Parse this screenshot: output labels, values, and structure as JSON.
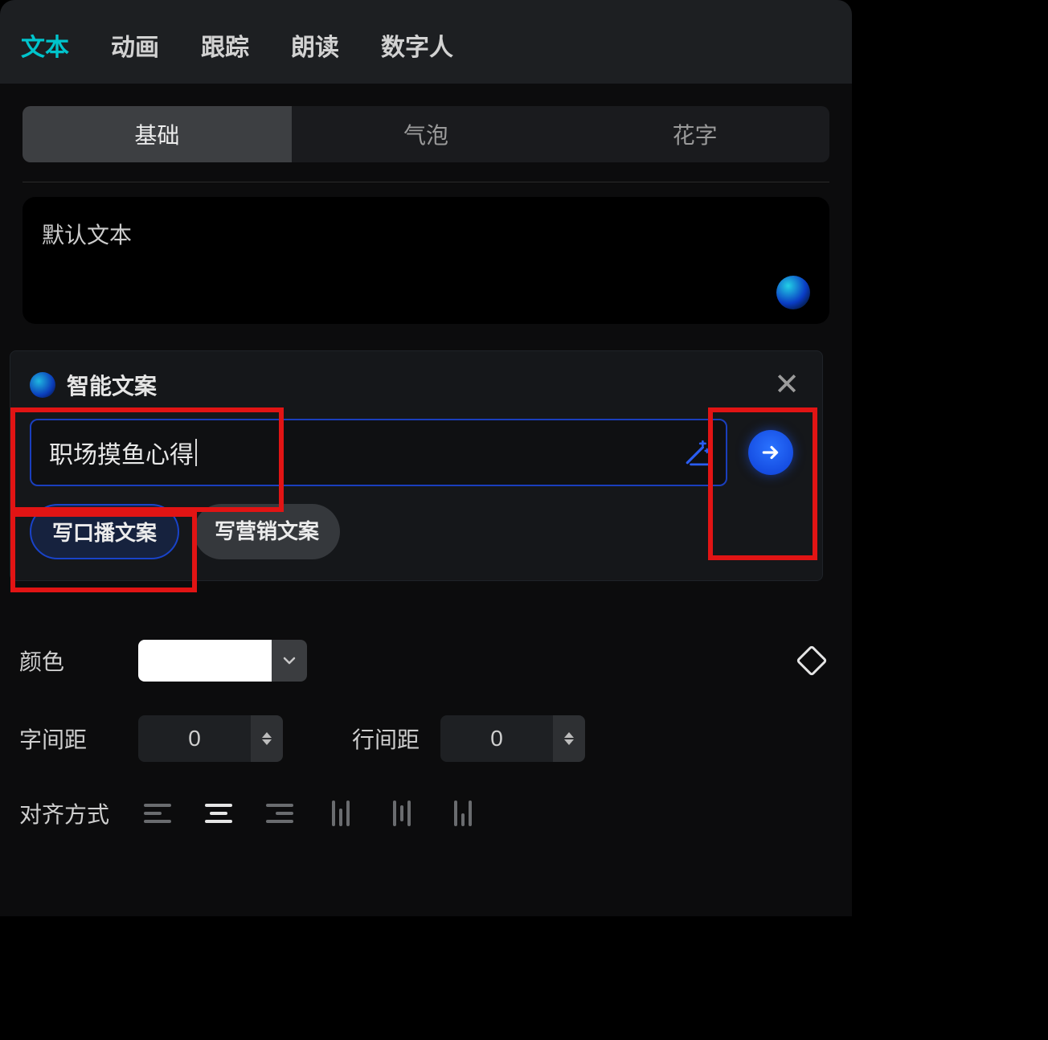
{
  "topTabs": {
    "text": "文本",
    "animation": "动画",
    "track": "跟踪",
    "read": "朗读",
    "digital": "数字人",
    "active": "text"
  },
  "subTabs": {
    "basic": "基础",
    "bubble": "气泡",
    "fancy": "花字",
    "active": "basic"
  },
  "textArea": {
    "value": "默认文本"
  },
  "popover": {
    "title": "智能文案",
    "input": "职场摸鱼心得",
    "chips": {
      "broadcast": "写口播文案",
      "marketing": "写营销文案"
    }
  },
  "props": {
    "colorLabel": "颜色",
    "colorValue": "#FFFFFF",
    "letterSpacingLabel": "字间距",
    "letterSpacingValue": "0",
    "lineSpacingLabel": "行间距",
    "lineSpacingValue": "0",
    "alignLabel": "对齐方式"
  },
  "icons": {
    "wand": "magic-wand-icon",
    "submit": "arrow-right-icon",
    "close": "close-icon",
    "chevronDown": "chevron-down-icon"
  }
}
